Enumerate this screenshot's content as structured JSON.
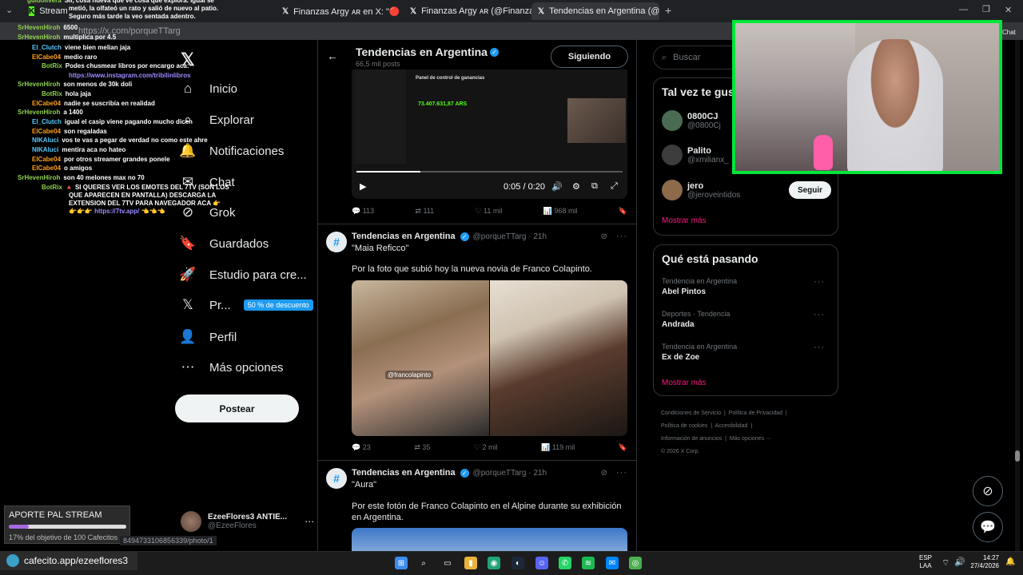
{
  "browser": {
    "tabs": [
      {
        "title": "Stream - K",
        "icon": "kick-icon"
      },
      {
        "title": "Finanzas Argy ᴀʀ en X: \"🔴 La...",
        "icon": "x-icon"
      },
      {
        "title": "Finanzas Argy ᴀʀ (@FinanzasArgy)",
        "icon": "x-icon"
      },
      {
        "title": "Tendencias en Argentina (@porqu",
        "icon": "x-icon"
      }
    ],
    "url": "https://x.com/porqueTTarg",
    "status_url": "8494733106856339/photo/1",
    "side_label": "Chat"
  },
  "sidebar": {
    "items": [
      {
        "label": "Inicio",
        "icon": "home-icon",
        "glyph": "⌂"
      },
      {
        "label": "Explorar",
        "icon": "search-icon",
        "glyph": "⌕"
      },
      {
        "label": "Notificaciones",
        "icon": "bell-icon",
        "glyph": "🔔"
      },
      {
        "label": "Chat",
        "icon": "chat-icon",
        "glyph": "✉"
      },
      {
        "label": "Grok",
        "icon": "grok-icon",
        "glyph": "⊘"
      },
      {
        "label": "Guardados",
        "icon": "bookmark-icon",
        "glyph": "🔖"
      },
      {
        "label": "Estudio para cre...",
        "icon": "rocket-icon",
        "glyph": "🚀"
      },
      {
        "label": "Pr...",
        "icon": "x-premium-icon",
        "glyph": "𝕏"
      },
      {
        "label": "Perfil",
        "icon": "profile-icon",
        "glyph": "👤"
      },
      {
        "label": "Más opciones",
        "icon": "more-icon",
        "glyph": "⋯"
      }
    ],
    "promo_badge": "50 % de descuento",
    "post_button": "Postear",
    "account": {
      "name": "EzeeFlores3 ANTIE...",
      "handle": "@EzeeFlores"
    }
  },
  "profile_header": {
    "title": "Tendencias en Argentina",
    "posts": "66,5 mil posts",
    "follow_button": "Siguiendo"
  },
  "video_post": {
    "panel_title": "Panel de control de ganancias",
    "amount": "73.407.631,87 ARS",
    "time": "0:05 / 0:20",
    "stats": {
      "replies": "113",
      "reposts": "111",
      "likes": "11 mil",
      "views": "968 mil"
    }
  },
  "posts": [
    {
      "author": "Tendencias en Argentina",
      "handle": "@porqueTTarg · 21h",
      "quote": "\"Maia Reficco\"",
      "text": "Por la foto que subió hoy la nueva novia de Franco Colapinto.",
      "tag": "@francolapinto",
      "stats": {
        "replies": "23",
        "reposts": "35",
        "likes": "2 mil",
        "views": "119 mil"
      }
    },
    {
      "author": "Tendencias en Argentina",
      "handle": "@porqueTTarg · 21h",
      "quote": "\"Aura\"",
      "text": "Por este fotón de Franco Colapinto en el Alpine durante su exhibición en Argentina."
    }
  ],
  "right": {
    "search_placeholder": "Buscar",
    "suggest_title": "Tal vez te gust",
    "suggestions": [
      {
        "name": "0800CJ",
        "handle": "@0800Cj"
      },
      {
        "name": "Palito",
        "handle": "@xmilianx_"
      },
      {
        "name": "jero",
        "handle": "@jeroveintidos"
      }
    ],
    "follow_button": "Seguir",
    "show_more": "Mostrar más",
    "trends_title": "Qué está pasando",
    "trends": [
      {
        "category": "Tendencia en Argentina",
        "name": "Abel Pintos"
      },
      {
        "category": "Deportes · Tendencia",
        "name": "Andrada"
      },
      {
        "category": "Tendencia en Argentina",
        "name": "Ex de Zoe"
      }
    ],
    "footer": [
      "Condiciones de Servicio",
      "Política de Privacidad",
      "Política de cookies",
      "Accesibilidad",
      "Información de anuncios",
      "Más opciones ···",
      "© 2026 X Corp."
    ]
  },
  "chat": [
    {
      "user": "guidolivera",
      "color": "#8fd14f",
      "msg": "Sii, cosa nueva que ve cosa que explora. igual se"
    },
    {
      "user": "",
      "color": "#ffffff",
      "msg": "metió, la olfateó un rato y salió de nuevo al patio."
    },
    {
      "user": "",
      "color": "#ffffff",
      "msg": "Seguro más tarde la veo sentada adentro."
    },
    {
      "user": "SrHevenHiroh",
      "color": "#8fd14f",
      "msg": "6500"
    },
    {
      "user": "SrHevenHiroh",
      "color": "#8fd14f",
      "msg": "multiplica por 4.5"
    },
    {
      "user": "El_Clutch",
      "color": "#5ac8fa",
      "msg": "viene bien melian jaja"
    },
    {
      "user": "ElCabe04",
      "color": "#ff9f1c",
      "msg": "medio raro"
    },
    {
      "user": "BotRix",
      "color": "#8fd14f",
      "msg": "Podes chusmear libros por encargo aca:"
    },
    {
      "user": "",
      "color": "#9b8cff",
      "msg": "https://www.instagram.com/tribilinlibros"
    },
    {
      "user": "SrHevenHiroh",
      "color": "#8fd14f",
      "msg": "son menos de 30k doli"
    },
    {
      "user": "BotRix",
      "color": "#8fd14f",
      "msg": "hola jaja"
    },
    {
      "user": "ElCabe04",
      "color": "#ff9f1c",
      "msg": "nadie se suscribía en realidad"
    },
    {
      "user": "SrHevenHiroh",
      "color": "#8fd14f",
      "msg": "a 1400"
    },
    {
      "user": "El_Clutch",
      "color": "#5ac8fa",
      "msg": "igual el casip viene pagando mucho dicen"
    },
    {
      "user": "ElCabe04",
      "color": "#ff9f1c",
      "msg": "son regaladas"
    },
    {
      "user": "NIKAluci",
      "color": "#5ac8fa",
      "msg": "vos te vas a pegar de verdad no como este ahre"
    },
    {
      "user": "NIKAluci",
      "color": "#5ac8fa",
      "msg": "mentira aca no hateo"
    },
    {
      "user": "ElCabe04",
      "color": "#ff9f1c",
      "msg": "por otros streamer grandes ponele"
    },
    {
      "user": "ElCabe04",
      "color": "#ff9f1c",
      "msg": "o amigos"
    },
    {
      "user": "SrHevenHiroh",
      "color": "#8fd14f",
      "msg": "son 40 melones max no 70"
    },
    {
      "user": "BotRix",
      "color": "#8fd14f",
      "msg": "🔺 SI QUERES VER LOS EMOTES DEL 7TV (SON LOS"
    },
    {
      "user": "",
      "color": "#ffffff",
      "msg": "QUE APARECEN EN PANTALLA) DESCARGA LA"
    },
    {
      "user": "",
      "color": "#ffffff",
      "msg": "EXTENSION DEL 7TV PARA NAVEGADOR ACA 👉"
    },
    {
      "user": "",
      "color": "#9b8cff",
      "msg": "👉👉👉 https://7tv.app/ 👈👈👈"
    }
  ],
  "overlay": {
    "aporte_title": "APORTE PAL STREAM",
    "aporte_progress": 0.17,
    "aporte_text": "17% del objetivo de 100 Cafecitos",
    "cafecito": "cafecito.app/ezeeflores3"
  },
  "taskbar": {
    "lang": "ESP",
    "lang2": "LAA",
    "time": "14:27",
    "date": "27/4/2026"
  },
  "colors": {
    "accent": "#1d9bf0",
    "pink": "#f91880",
    "cam_border": "#00e639"
  }
}
